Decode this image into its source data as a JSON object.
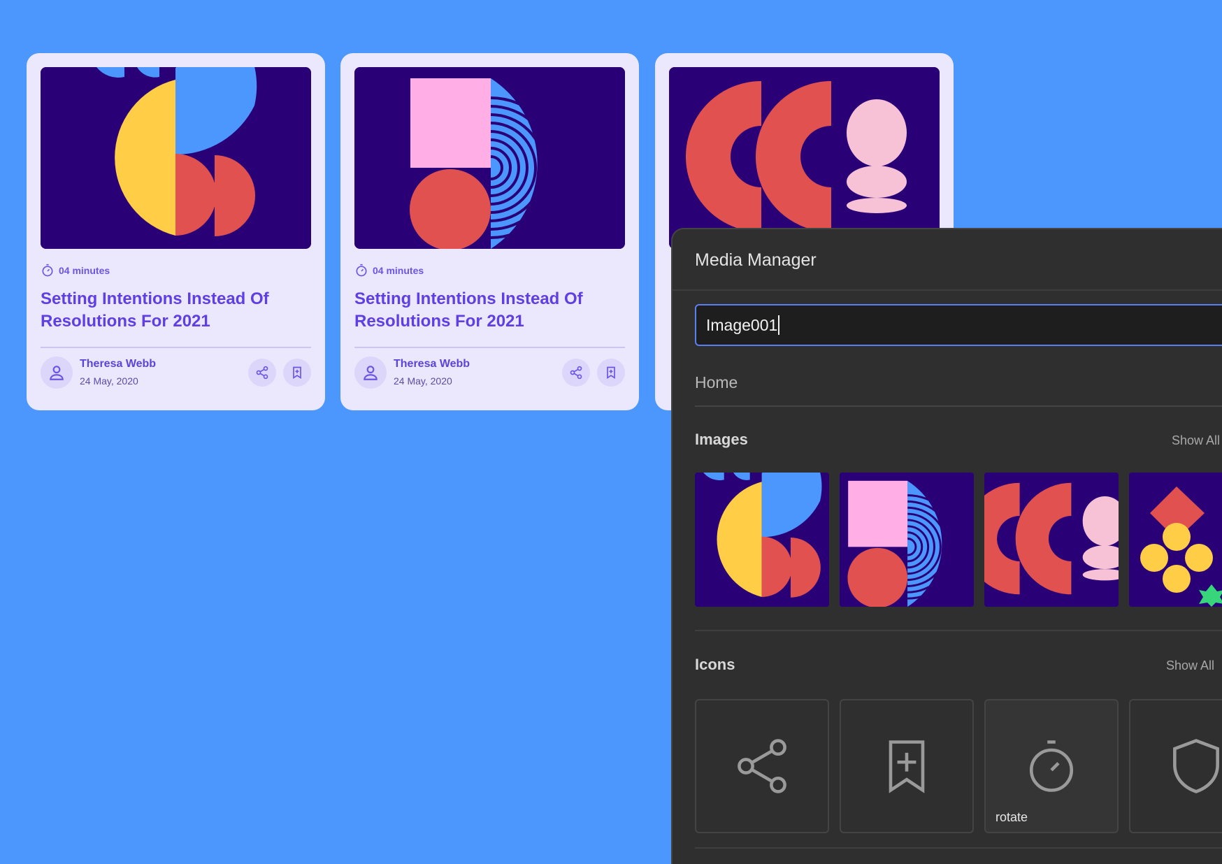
{
  "cards": [
    {
      "read_time": "04 minutes",
      "title": "Setting Intentions Instead Of Resolutions For 2021",
      "author": "Theresa Webb",
      "date": "24 May, 2020",
      "artwork": "yellow-blue-red-circles"
    },
    {
      "read_time": "04 minutes",
      "title": "Setting Intentions Instead Of Resolutions For 2021",
      "author": "Theresa Webb",
      "date": "24 May, 2020",
      "artwork": "pink-square-concentric-arcs"
    },
    {
      "artwork": "red-arcs-pink-shapes"
    }
  ],
  "media_manager": {
    "title": "Media Manager",
    "search_value": "Image001",
    "breadcrumb": "Home",
    "images_section": {
      "title": "Images",
      "show_all": "Show All",
      "tiles": [
        "yellow-blue-red-circles",
        "pink-square-concentric-arcs",
        "red-arcs-pink-shapes",
        "red-diamond-yellow-circles"
      ]
    },
    "icons_section": {
      "title": "Icons",
      "show_all": "Show All",
      "tiles": [
        {
          "icon": "share-icon",
          "label": ""
        },
        {
          "icon": "bookmark-add-icon",
          "label": ""
        },
        {
          "icon": "timer-icon",
          "label": "rotate"
        },
        {
          "icon": "shield-icon",
          "label": ""
        }
      ]
    }
  },
  "colors": {
    "background": "#4c97fe",
    "card": "#ebe8fd",
    "accent": "#5f3fe3",
    "art_navy": "#2a0077",
    "panel": "#2f2f2f",
    "input_focus": "#5a7ff0"
  }
}
